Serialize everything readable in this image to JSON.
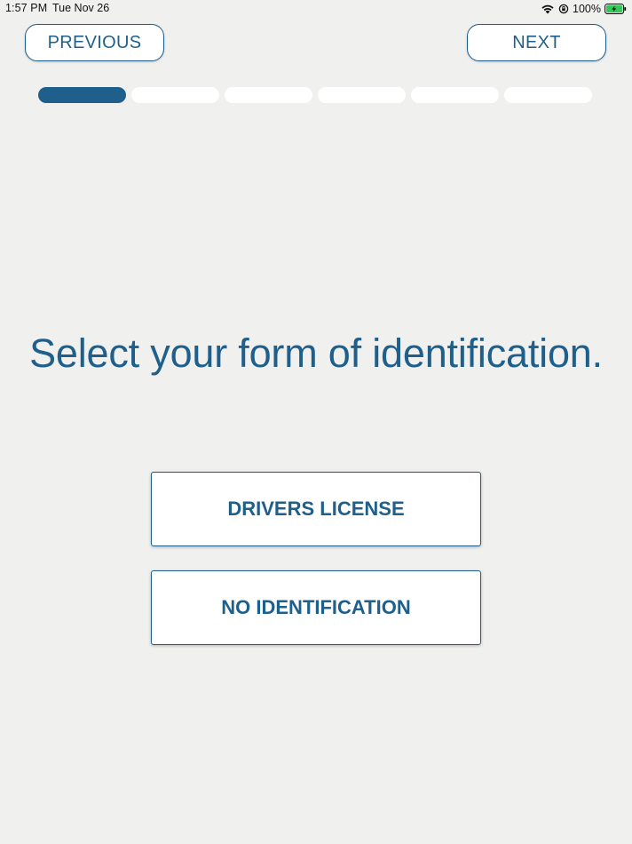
{
  "status_bar": {
    "time": "1:57 PM",
    "date": "Tue Nov 26",
    "battery_percent": "100%",
    "icons": [
      "wifi-icon",
      "orientation-lock-icon",
      "battery-charging-icon"
    ]
  },
  "nav": {
    "previous_label": "PREVIOUS",
    "next_label": "NEXT"
  },
  "progress": {
    "total_steps": 6,
    "current_step": 1
  },
  "main": {
    "heading": "Select your form of identification.",
    "options": [
      {
        "label": "DRIVERS LICENSE"
      },
      {
        "label": "NO IDENTIFICATION"
      }
    ]
  },
  "colors": {
    "accent": "#1f5f8b",
    "background": "#f0f0ef",
    "surface": "#ffffff",
    "battery": "#34c759"
  }
}
